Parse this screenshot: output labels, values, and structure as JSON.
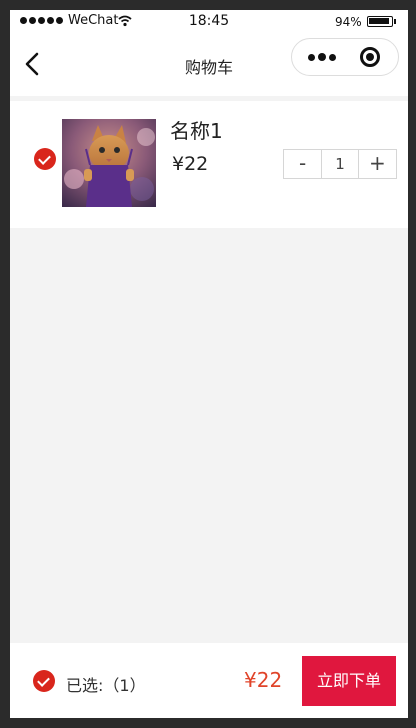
{
  "status_bar": {
    "carrier": "WeChat",
    "time": "18:45",
    "battery": "94%",
    "battery_level": 0.94
  },
  "nav": {
    "title": "购物车",
    "back_icon": "chevron-left-icon",
    "more_icon": "more-dots-icon",
    "close_icon": "target-close-icon"
  },
  "cart": {
    "items": [
      {
        "name": "名称1",
        "price": "¥22",
        "quantity": "1",
        "minus_label": "-",
        "plus_label": "+",
        "checked": true
      }
    ]
  },
  "footer": {
    "selected_label": "已选:（1）",
    "total": "¥22",
    "order_button": "立即下单",
    "all_checked": true
  },
  "colors": {
    "accent_red": "#d9261c",
    "price_red": "#e0442a",
    "order_button_bg": "#e0173e",
    "page_bg": "#f3f3f3"
  }
}
